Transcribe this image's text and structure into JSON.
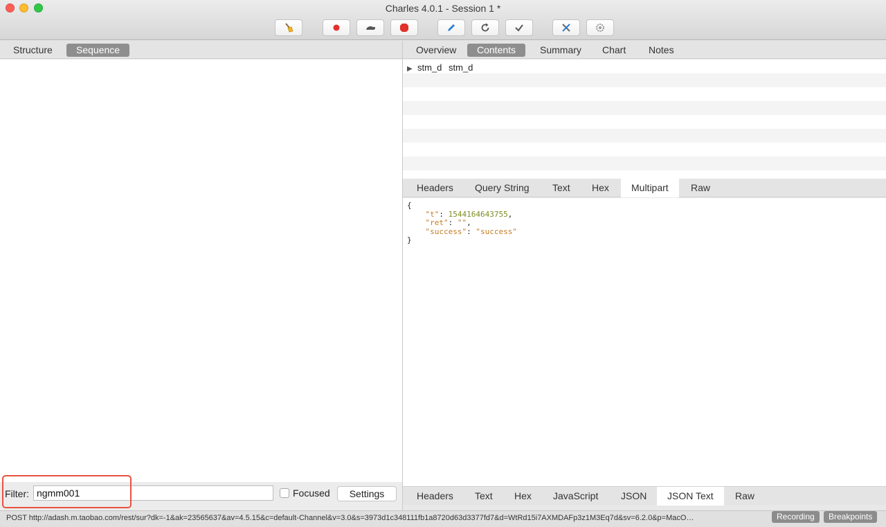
{
  "window": {
    "title": "Charles 4.0.1 - Session 1 *"
  },
  "toolbar": {
    "icons": [
      "broom-icon",
      "record-icon",
      "throttle-icon",
      "breakpoints-icon",
      "compose-icon",
      "repeat-icon",
      "validate-icon",
      "tools-icon",
      "settings-icon"
    ],
    "colors": {
      "record": "#e0312a",
      "compose": "#2a7fd6"
    }
  },
  "left": {
    "tabs": [
      {
        "label": "Structure",
        "active": false
      },
      {
        "label": "Sequence",
        "active": true
      }
    ],
    "filter": {
      "label": "Filter:",
      "value": "ngmm001",
      "focused_label": "Focused",
      "settings_label": "Settings"
    }
  },
  "right": {
    "tabs": [
      {
        "label": "Overview",
        "active": false
      },
      {
        "label": "Contents",
        "active": true
      },
      {
        "label": "Summary",
        "active": false
      },
      {
        "label": "Chart",
        "active": false
      },
      {
        "label": "Notes",
        "active": false
      }
    ],
    "tree": {
      "key": "stm_d",
      "value": "stm_d"
    },
    "request_tabs": [
      {
        "label": "Headers",
        "active": false
      },
      {
        "label": "Query String",
        "active": false
      },
      {
        "label": "Text",
        "active": false
      },
      {
        "label": "Hex",
        "active": false
      },
      {
        "label": "Multipart",
        "active": true
      },
      {
        "label": "Raw",
        "active": false
      }
    ],
    "json": {
      "open": "{",
      "close": "}",
      "lines": [
        {
          "key": "\"t\"",
          "value": "1544164643755",
          "sep": ","
        },
        {
          "key": "\"ret\"",
          "value": "\"\"",
          "sep": ","
        },
        {
          "key": "\"success\"",
          "value": "\"success\"",
          "sep": ""
        }
      ]
    },
    "response_tabs": [
      {
        "label": "Headers",
        "active": false
      },
      {
        "label": "Text",
        "active": false
      },
      {
        "label": "Hex",
        "active": false
      },
      {
        "label": "JavaScript",
        "active": false
      },
      {
        "label": "JSON",
        "active": false
      },
      {
        "label": "JSON Text",
        "active": true
      },
      {
        "label": "Raw",
        "active": false
      }
    ]
  },
  "status": {
    "text": "POST http://adash.m.taobao.com/rest/sur?dk=-1&ak=23565637&av=4.5.15&c=default-Channel&v=3.0&s=3973d1c348111fb1a8720d63d3377fd7&d=WtRd15i7AXMDAFp3z1M3Eq7d&sv=6.2.0&p=MacO…",
    "recording_label": "Recording",
    "breakpoints_label": "Breakpoints"
  }
}
